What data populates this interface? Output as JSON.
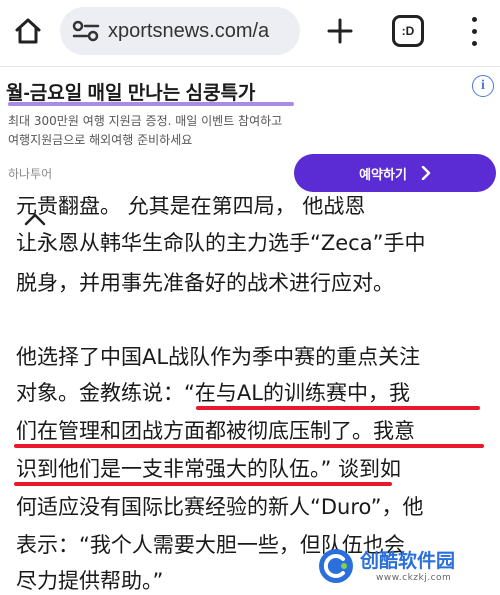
{
  "browser": {
    "url": "xportsnews.com/a",
    "tab_count": ":D"
  },
  "ad": {
    "title": "월-금요일 매일 만나는 심쿵특가",
    "desc_line1": "최대 300만원 여행 지원금 증정. 매일 이벤트 참여하고",
    "desc_line2": "여행지원금으로 해외여행 준비하세요",
    "advertiser": "하나투어",
    "cta_label": "예약하기",
    "info_label": "i",
    "accent_color": "#5b2bd3"
  },
  "article": {
    "lines": [
      "元贵翻盘。 允其是在第四局， 他战恩",
      "让永恩从韩华生命队的主力选手“Zeca”手中",
      "脱身，并用事先准备好的战术进行应对。",
      "他选择了中国AL战队作为季中赛的重点关注",
      "对象。金教练说：“在与AL的训练赛中，我",
      "们在管理和团战方面都被彻底压制了。我意",
      "识到他们是一支非常强大的队伍。” 谈到如",
      "何适应没有国际比赛经验的新人“Duro”，他",
      "表示：“我个人需要大胆一些，但队伍也会",
      "尽力提供帮助。”"
    ],
    "highlight_color": "#e8192c"
  },
  "watermark": {
    "name": "创酷软件园",
    "url": "www.ckzkj.com"
  }
}
